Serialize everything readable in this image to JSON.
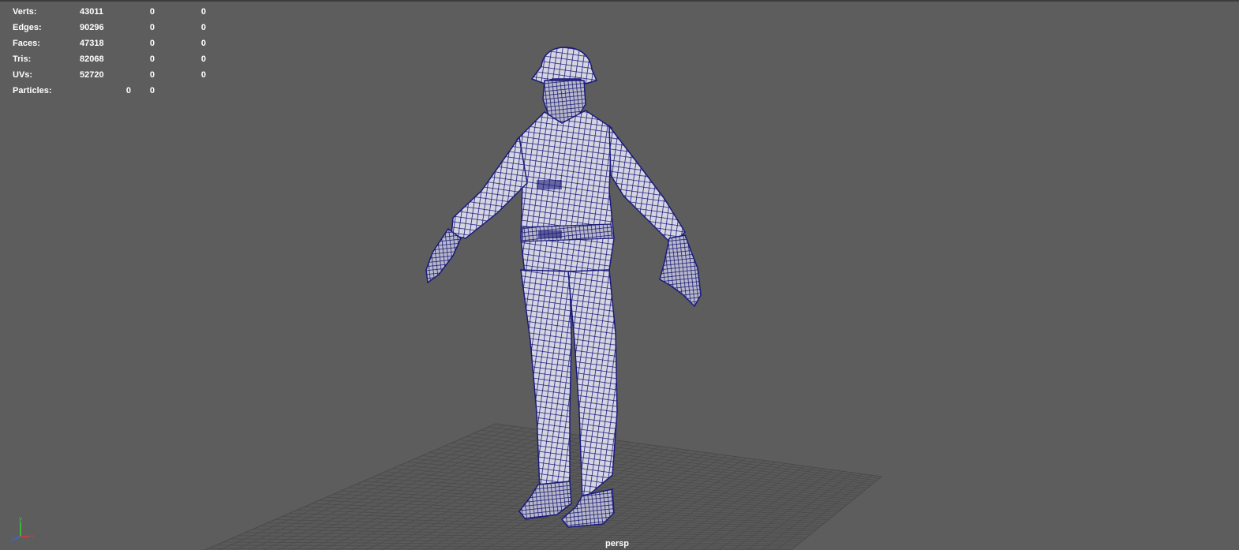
{
  "hud": {
    "rows": [
      {
        "label": "Verts:",
        "values": [
          "43011",
          "0",
          "0"
        ]
      },
      {
        "label": "Edges:",
        "values": [
          "90296",
          "0",
          "0"
        ]
      },
      {
        "label": "Faces:",
        "values": [
          "47318",
          "0",
          "0"
        ]
      },
      {
        "label": "Tris:",
        "values": [
          "82068",
          "0",
          "0"
        ]
      },
      {
        "label": "UVs:",
        "values": [
          "52720",
          "0",
          "0"
        ]
      }
    ],
    "particles": {
      "label": "Particles:",
      "values": [
        "0",
        "0"
      ]
    }
  },
  "viewport": {
    "camera": "persp",
    "background_color": "#5d5d5d",
    "wireframe_color": "#1a1a7a",
    "grid_color": "#4a4a4a",
    "object": "wireframe-character-model"
  },
  "axis_gizmo": {
    "x": "x",
    "y": "y",
    "z": "z",
    "colors": {
      "x": "#d23c3c",
      "y": "#3cc83c",
      "z": "#3c64e6"
    }
  }
}
